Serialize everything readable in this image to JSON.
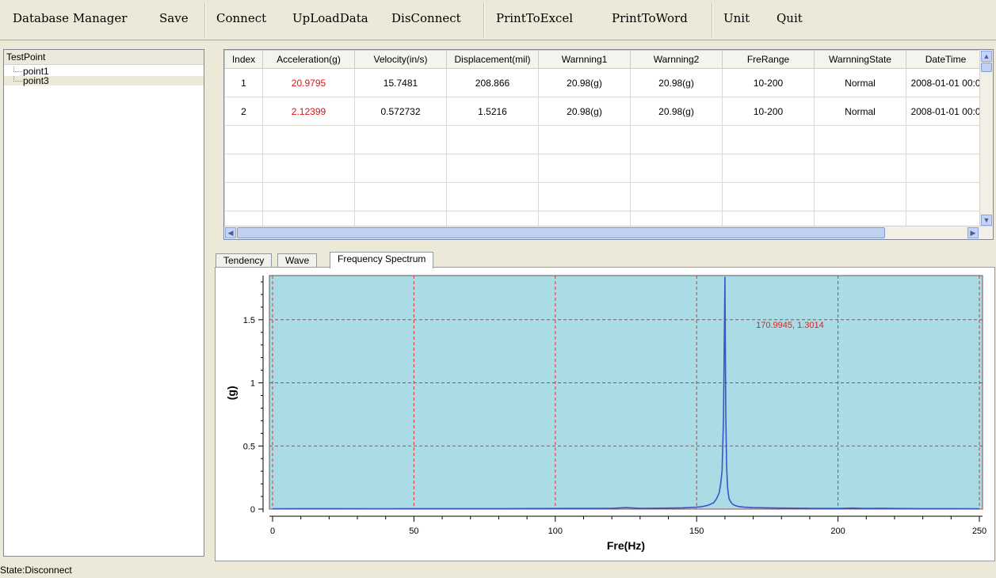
{
  "toolbar": {
    "groups": [
      [
        "Database Manager",
        "Save"
      ],
      [
        "Connect",
        "UpLoadData",
        "DisConnect"
      ],
      [
        "PrintToExcel",
        "PrintToWord"
      ],
      [
        "Unit",
        "Quit"
      ]
    ]
  },
  "tree": {
    "header": "TestPoint",
    "items": [
      {
        "label": "point1",
        "selected": false
      },
      {
        "label": "point3",
        "selected": true
      }
    ]
  },
  "grid": {
    "columns": [
      "Index",
      "Acceleration(g)",
      "Velocity(in/s)",
      "Displacement(mil)",
      "Warnning1",
      "Warnning2",
      "FreRange",
      "WarnningState",
      "DateTime"
    ],
    "rows": [
      [
        "1",
        "20.9795",
        "15.7481",
        "208.866",
        "20.98(g)",
        "20.98(g)",
        "10-200",
        "Normal",
        "2008-01-01 00:0"
      ],
      [
        "2",
        "2.12399",
        "0.572732",
        "1.5216",
        "20.98(g)",
        "20.98(g)",
        "10-200",
        "Normal",
        "2008-01-01 00:0"
      ]
    ],
    "empty_rows": 4,
    "highlight_color": "#e01010"
  },
  "tabs": [
    {
      "label": "Tendency",
      "active": false
    },
    {
      "label": "Wave",
      "active": false
    },
    {
      "label": "Frequency Spectrum",
      "active": true
    }
  ],
  "chart_data": {
    "type": "line",
    "xlabel": "Fre(Hz)",
    "ylabel": "(g)",
    "xlim": [
      0,
      250
    ],
    "ylim": [
      0,
      1.85
    ],
    "xticks": [
      0,
      50,
      100,
      150,
      200,
      250
    ],
    "yticks": [
      0,
      0.5,
      1,
      1.5
    ],
    "grid": true,
    "background_color": "#aadce6",
    "line_color": "#3b55c8",
    "grid_color": "#e03030",
    "annotation": {
      "text": "170.9945, 1.3014",
      "color": "#e02020"
    },
    "series": [
      {
        "x": [
          0,
          20,
          40,
          60,
          80,
          100,
          120,
          125,
          130,
          140,
          145,
          150,
          152,
          154,
          156,
          157,
          158,
          158.5,
          159,
          159.5,
          160,
          160.3,
          160.6,
          160.9,
          161.2,
          161.5,
          162,
          162.5,
          163,
          164,
          165,
          167,
          170,
          175,
          180,
          190,
          200,
          205,
          210,
          215,
          220,
          230,
          240,
          250
        ],
        "y": [
          0.003,
          0.004,
          0.003,
          0.004,
          0.004,
          0.005,
          0.006,
          0.012,
          0.006,
          0.008,
          0.01,
          0.015,
          0.02,
          0.03,
          0.05,
          0.08,
          0.13,
          0.2,
          0.3,
          0.72,
          1.84,
          0.75,
          0.35,
          0.18,
          0.12,
          0.08,
          0.06,
          0.045,
          0.035,
          0.025,
          0.02,
          0.015,
          0.012,
          0.01,
          0.008,
          0.006,
          0.005,
          0.008,
          0.005,
          0.007,
          0.005,
          0.004,
          0.004,
          0.003
        ]
      }
    ]
  },
  "status": {
    "text": "State:Disconnect"
  }
}
